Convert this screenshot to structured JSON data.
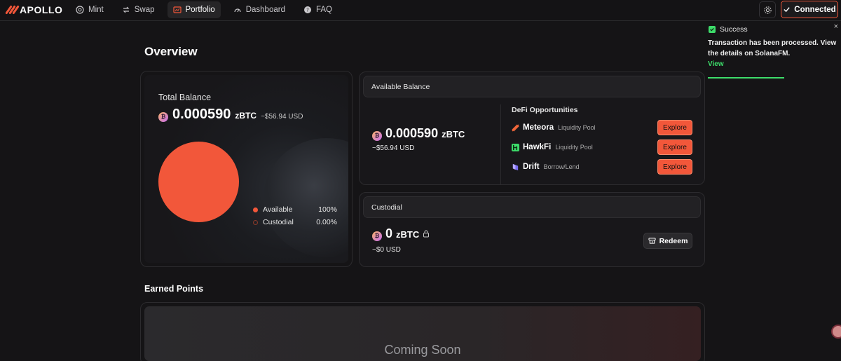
{
  "app": {
    "brand": "APOLLO"
  },
  "nav": {
    "mint": "Mint",
    "swap": "Swap",
    "portfolio": "Portfolio",
    "dashboard": "Dashboard",
    "faq": "FAQ"
  },
  "header": {
    "connected_label": "Connected"
  },
  "toast": {
    "title": "Success",
    "message": "Transaction has been processed. View the details on SolanaFM.",
    "link": "View",
    "close": "×"
  },
  "overview": {
    "title": "Overview",
    "total_balance": {
      "label": "Total Balance",
      "amount": "0.000590",
      "unit": "zBTC",
      "usd": "~$56.94 USD"
    },
    "legend": [
      {
        "name": "Available",
        "value": "100%"
      },
      {
        "name": "Custodial",
        "value": "0.00%"
      }
    ]
  },
  "available": {
    "title": "Available Balance",
    "amount": "0.000590",
    "unit": "zBTC",
    "usd": "~$56.94 USD",
    "defi_title": "DeFi Opportunities",
    "opportunities": [
      {
        "name": "Meteora",
        "type": "Liquidity Pool",
        "action": "Explore"
      },
      {
        "name": "HawkFi",
        "type": "Liquidity Pool",
        "action": "Explore"
      },
      {
        "name": "Drift",
        "type": "Borrow/Lend",
        "action": "Explore"
      }
    ]
  },
  "custodial": {
    "title": "Custodial",
    "amount": "0",
    "unit": "zBTC",
    "usd": "~$0 USD",
    "redeem_label": "Redeem"
  },
  "earned": {
    "title": "Earned Points",
    "coming_soon": "Coming Soon"
  },
  "chart_data": {
    "type": "pie",
    "categories": [
      "Available",
      "Custodial"
    ],
    "values": [
      100,
      0
    ],
    "colors": [
      "#f2573a",
      "#8a3a2a"
    ]
  },
  "icons": {
    "coin": "₿"
  }
}
